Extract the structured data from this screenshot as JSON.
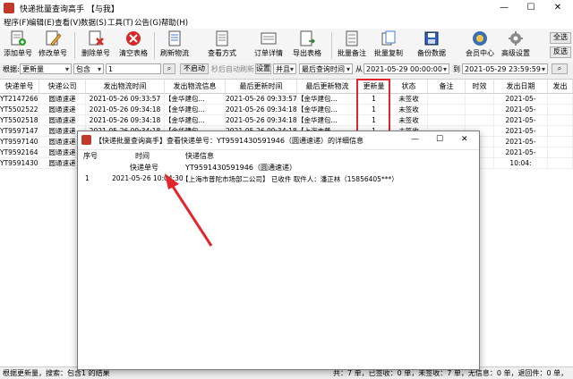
{
  "window": {
    "title": "快递批量查询高手 【与我】",
    "minimize": "—",
    "maximize": "☐",
    "close": "✕"
  },
  "menu": [
    "程序(F)",
    "编辑(E)",
    "查看(V)",
    "数据(S)",
    "工具(T)",
    "公告(G)",
    "帮助(H)"
  ],
  "toolbar": {
    "buttons": [
      {
        "label": "添加单号",
        "icon": "add-number-icon"
      },
      {
        "label": "修改单号",
        "icon": "edit-number-icon"
      },
      {
        "label": "删除单号",
        "icon": "delete-number-icon"
      },
      {
        "label": "清空表格",
        "icon": "clear-table-icon"
      },
      {
        "label": "刷新物流",
        "icon": "refresh-logistics-icon"
      },
      {
        "label": "查看方式",
        "icon": "view-mode-icon"
      },
      {
        "label": "订单详情",
        "icon": "order-detail-icon"
      },
      {
        "label": "导出表格",
        "icon": "export-table-icon"
      },
      {
        "label": "批量备注",
        "icon": "batch-note-icon"
      },
      {
        "label": "批量复制",
        "icon": "batch-copy-icon"
      },
      {
        "label": "备份数据",
        "icon": "backup-data-icon"
      },
      {
        "label": "会员中心",
        "icon": "member-center-icon"
      },
      {
        "label": "高级设置",
        "icon": "advanced-settings-icon"
      }
    ],
    "select_all": "全选",
    "invert": "反选"
  },
  "filter": {
    "label": "根据:",
    "field": "更新量",
    "op": "包含",
    "value": "1",
    "search_icon": "search-icon",
    "not_started": "不启动",
    "auto_refresh": "秒后自动刷新",
    "settings": "设置",
    "logic": "并且",
    "time_field": "最后查询时间",
    "from_label": "从",
    "from": "2021-05-29 00:00:00",
    "to_label": "到",
    "to": "2021-05-29 23:59:59"
  },
  "grid": {
    "columns": [
      "快递单号",
      "快递公司",
      "发出物流时间",
      "发出物流信息",
      "最后更新时间",
      "最后更新物流",
      "更新量",
      "状态",
      "备注",
      "时效",
      "发出日期",
      "发出"
    ],
    "rows": [
      [
        "YT2147266...",
        "圆通速递",
        "2021-05-26 09:33:57",
        "【金华建包...",
        "2021-05-26 09:33:57",
        "【金华建包...",
        "1",
        "未签收",
        "",
        "",
        "2021-05-",
        ""
      ],
      [
        "YT5502522...",
        "圆通速递",
        "2021-05-26 09:34:18",
        "【金华建包...",
        "2021-05-26 09:34:18",
        "【金华建包...",
        "1",
        "未签收",
        "",
        "",
        "2021-05-",
        ""
      ],
      [
        "YT5502518...",
        "圆通速递",
        "2021-05-26 09:34:18",
        "【金华建包...",
        "2021-05-26 09:34:18",
        "【金华建包...",
        "1",
        "未签收",
        "",
        "",
        "2021-05-",
        ""
      ],
      [
        "YT9597147...",
        "圆通速递",
        "2021-05-26 09:34:18",
        "【金华建包...",
        "2021-05-26 09:34:18",
        "【上海市普...",
        "1",
        "未签收",
        "",
        "",
        "2021-05-",
        ""
      ],
      [
        "YT9597140...",
        "圆通速递",
        "",
        "",
        "",
        "",
        "",
        "",
        "",
        "",
        "2021-05-",
        ""
      ],
      [
        "YT9592164...",
        "圆通速递",
        "",
        "",
        "",
        "",
        "",
        "",
        "",
        "",
        "2021-05-",
        ""
      ],
      [
        "YT9591430...",
        "圆通速递",
        "",
        "",
        "",
        "",
        "",
        "",
        "",
        "",
        "10:04:",
        ""
      ]
    ]
  },
  "dialog": {
    "title": "【快递批量查询高手】查看快递单号：YT9591430591946（圆通速递）的详细信息",
    "minimize": "—",
    "maximize": "☐",
    "close": "✕",
    "headers": [
      "序号",
      "时间",
      "快递信息"
    ],
    "subheaders": [
      "快递单号",
      "YT9591430591946（圆通速递）"
    ],
    "row": {
      "num": "1",
      "time": "2021-05-26 10:04:30",
      "info": "【上海市普陀市场部二公司】 已收件 取件人：潘正林（15856405***）"
    }
  },
  "status": {
    "left": "根据更新量，搜索：包含1 的结果",
    "right": "共：7 单，已签收：0 单，未签收：7 单，无信息：0 单，退回件：0 单，"
  }
}
